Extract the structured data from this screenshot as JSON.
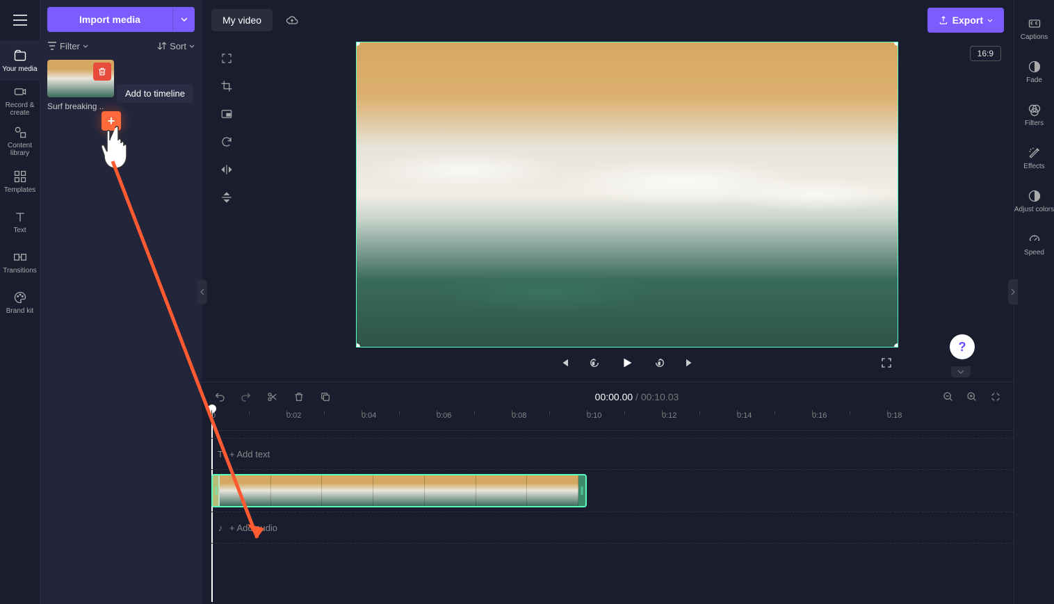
{
  "sidebar": {
    "items": [
      {
        "label": "Your media",
        "icon": "folder-media"
      },
      {
        "label": "Record & create",
        "icon": "camera"
      },
      {
        "label": "Content library",
        "icon": "shapes"
      },
      {
        "label": "Templates",
        "icon": "grid"
      },
      {
        "label": "Text",
        "icon": "text"
      },
      {
        "label": "Transitions",
        "icon": "transition"
      },
      {
        "label": "Brand kit",
        "icon": "palette"
      }
    ]
  },
  "mediaPanel": {
    "import_label": "Import media",
    "filter_label": "Filter",
    "sort_label": "Sort",
    "clip_name": "Surf breaking ..",
    "tooltip": "Add to timeline"
  },
  "header": {
    "title": "My video",
    "export_label": "Export"
  },
  "preview": {
    "aspect": "16:9"
  },
  "timeline": {
    "current": "00:00.00",
    "total": "00:10.03",
    "separator": " / ",
    "ticks": [
      "0",
      "0:02",
      "0:04",
      "0:06",
      "0:08",
      "0:10",
      "0:12",
      "0:14",
      "0:16",
      "0:18"
    ],
    "add_text_label": "+  Add text",
    "add_audio_label": "+  Add audio"
  },
  "rightRail": {
    "items": [
      {
        "label": "Captions",
        "icon": "cc"
      },
      {
        "label": "Fade",
        "icon": "fade"
      },
      {
        "label": "Filters",
        "icon": "filters"
      },
      {
        "label": "Effects",
        "icon": "effects"
      },
      {
        "label": "Adjust colors",
        "icon": "contrast"
      },
      {
        "label": "Speed",
        "icon": "speed"
      }
    ]
  },
  "help": "?"
}
